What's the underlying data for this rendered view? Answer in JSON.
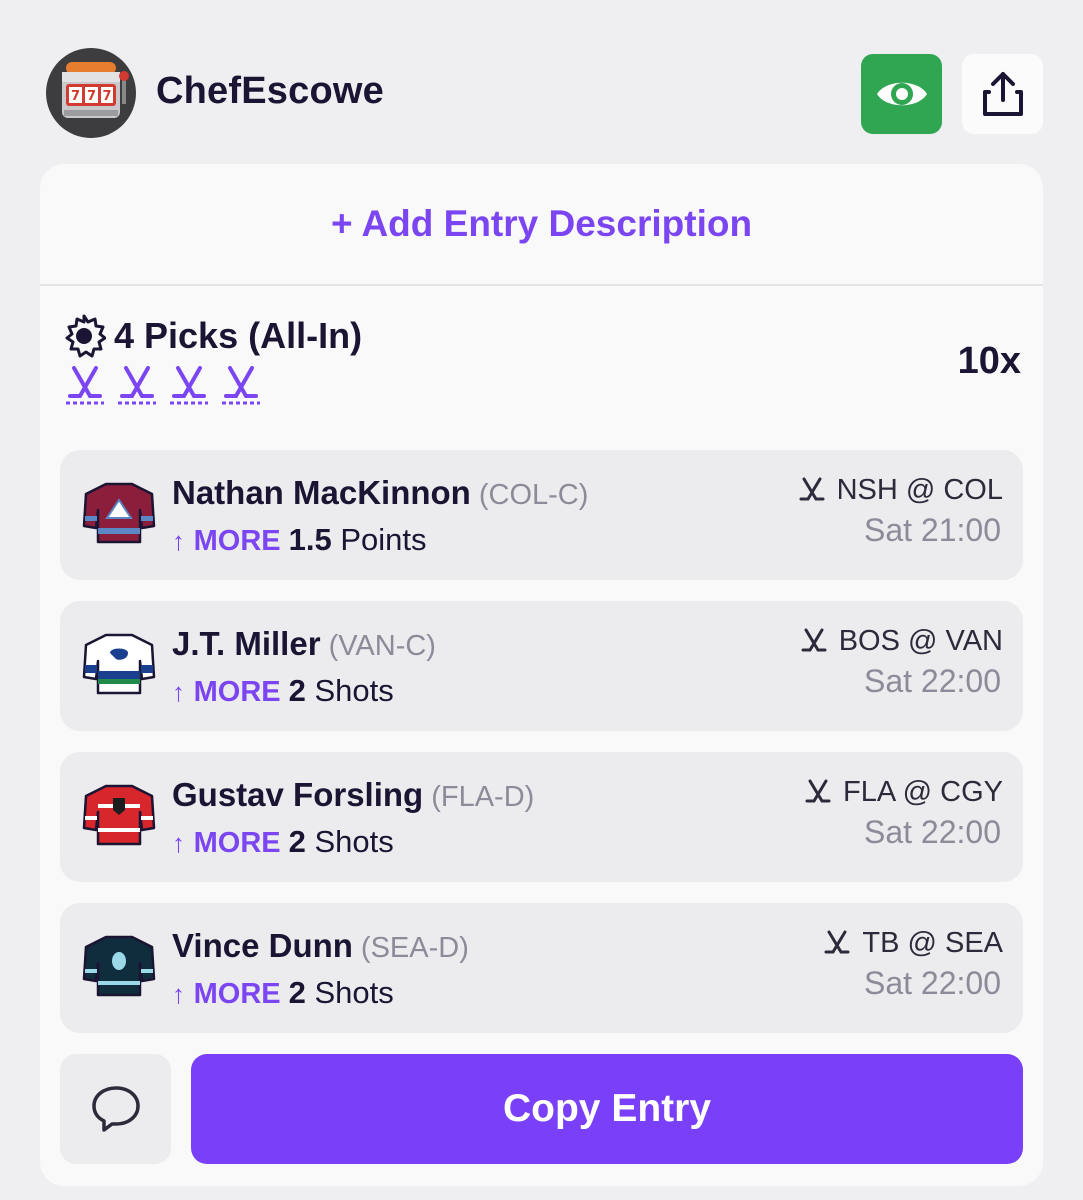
{
  "header": {
    "username": "ChefEscowe",
    "avatar_icon": "slot-machine-icon",
    "view_icon": "eye-icon",
    "share_icon": "share-icon"
  },
  "entry": {
    "add_description": "+ Add Entry Description",
    "picks_label": "4 Picks (All-In)",
    "multiplier": "10x",
    "sport_icon": "hockey-sticks-icon",
    "picks": [
      {
        "player": "Nathan MacKinnon",
        "position": "(COL-C)",
        "direction": "MORE",
        "line": "1.5",
        "stat": "Points",
        "game": "NSH @ COL",
        "time": "Sat 21:00",
        "jersey_colors": [
          "#8a1e3b",
          "#ffffff",
          "#5b87c5"
        ]
      },
      {
        "player": "J.T. Miller",
        "position": "(VAN-C)",
        "direction": "MORE",
        "line": "2",
        "stat": "Shots",
        "game": "BOS @ VAN",
        "time": "Sat 22:00",
        "jersey_colors": [
          "#ffffff",
          "#1b3f8f",
          "#1f8a4a"
        ]
      },
      {
        "player": "Gustav Forsling",
        "position": "(FLA-D)",
        "direction": "MORE",
        "line": "2",
        "stat": "Shots",
        "game": "FLA @ CGY",
        "time": "Sat 22:00",
        "jersey_colors": [
          "#d7262c",
          "#ffffff",
          "#1d1d1f"
        ]
      },
      {
        "player": "Vince Dunn",
        "position": "(SEA-D)",
        "direction": "MORE",
        "line": "2",
        "stat": "Shots",
        "game": "TB @ SEA",
        "time": "Sat 22:00",
        "jersey_colors": [
          "#0f2d3d",
          "#9bd8e8",
          "#1b1b1b"
        ]
      }
    ]
  },
  "actions": {
    "chat_icon": "chat-bubble-icon",
    "copy_label": "Copy Entry"
  },
  "colors": {
    "accent": "#7a3ff9",
    "accent_text": "#7b46f2",
    "green": "#30a552",
    "background": "#efeff1",
    "card": "#f9f9fa"
  }
}
